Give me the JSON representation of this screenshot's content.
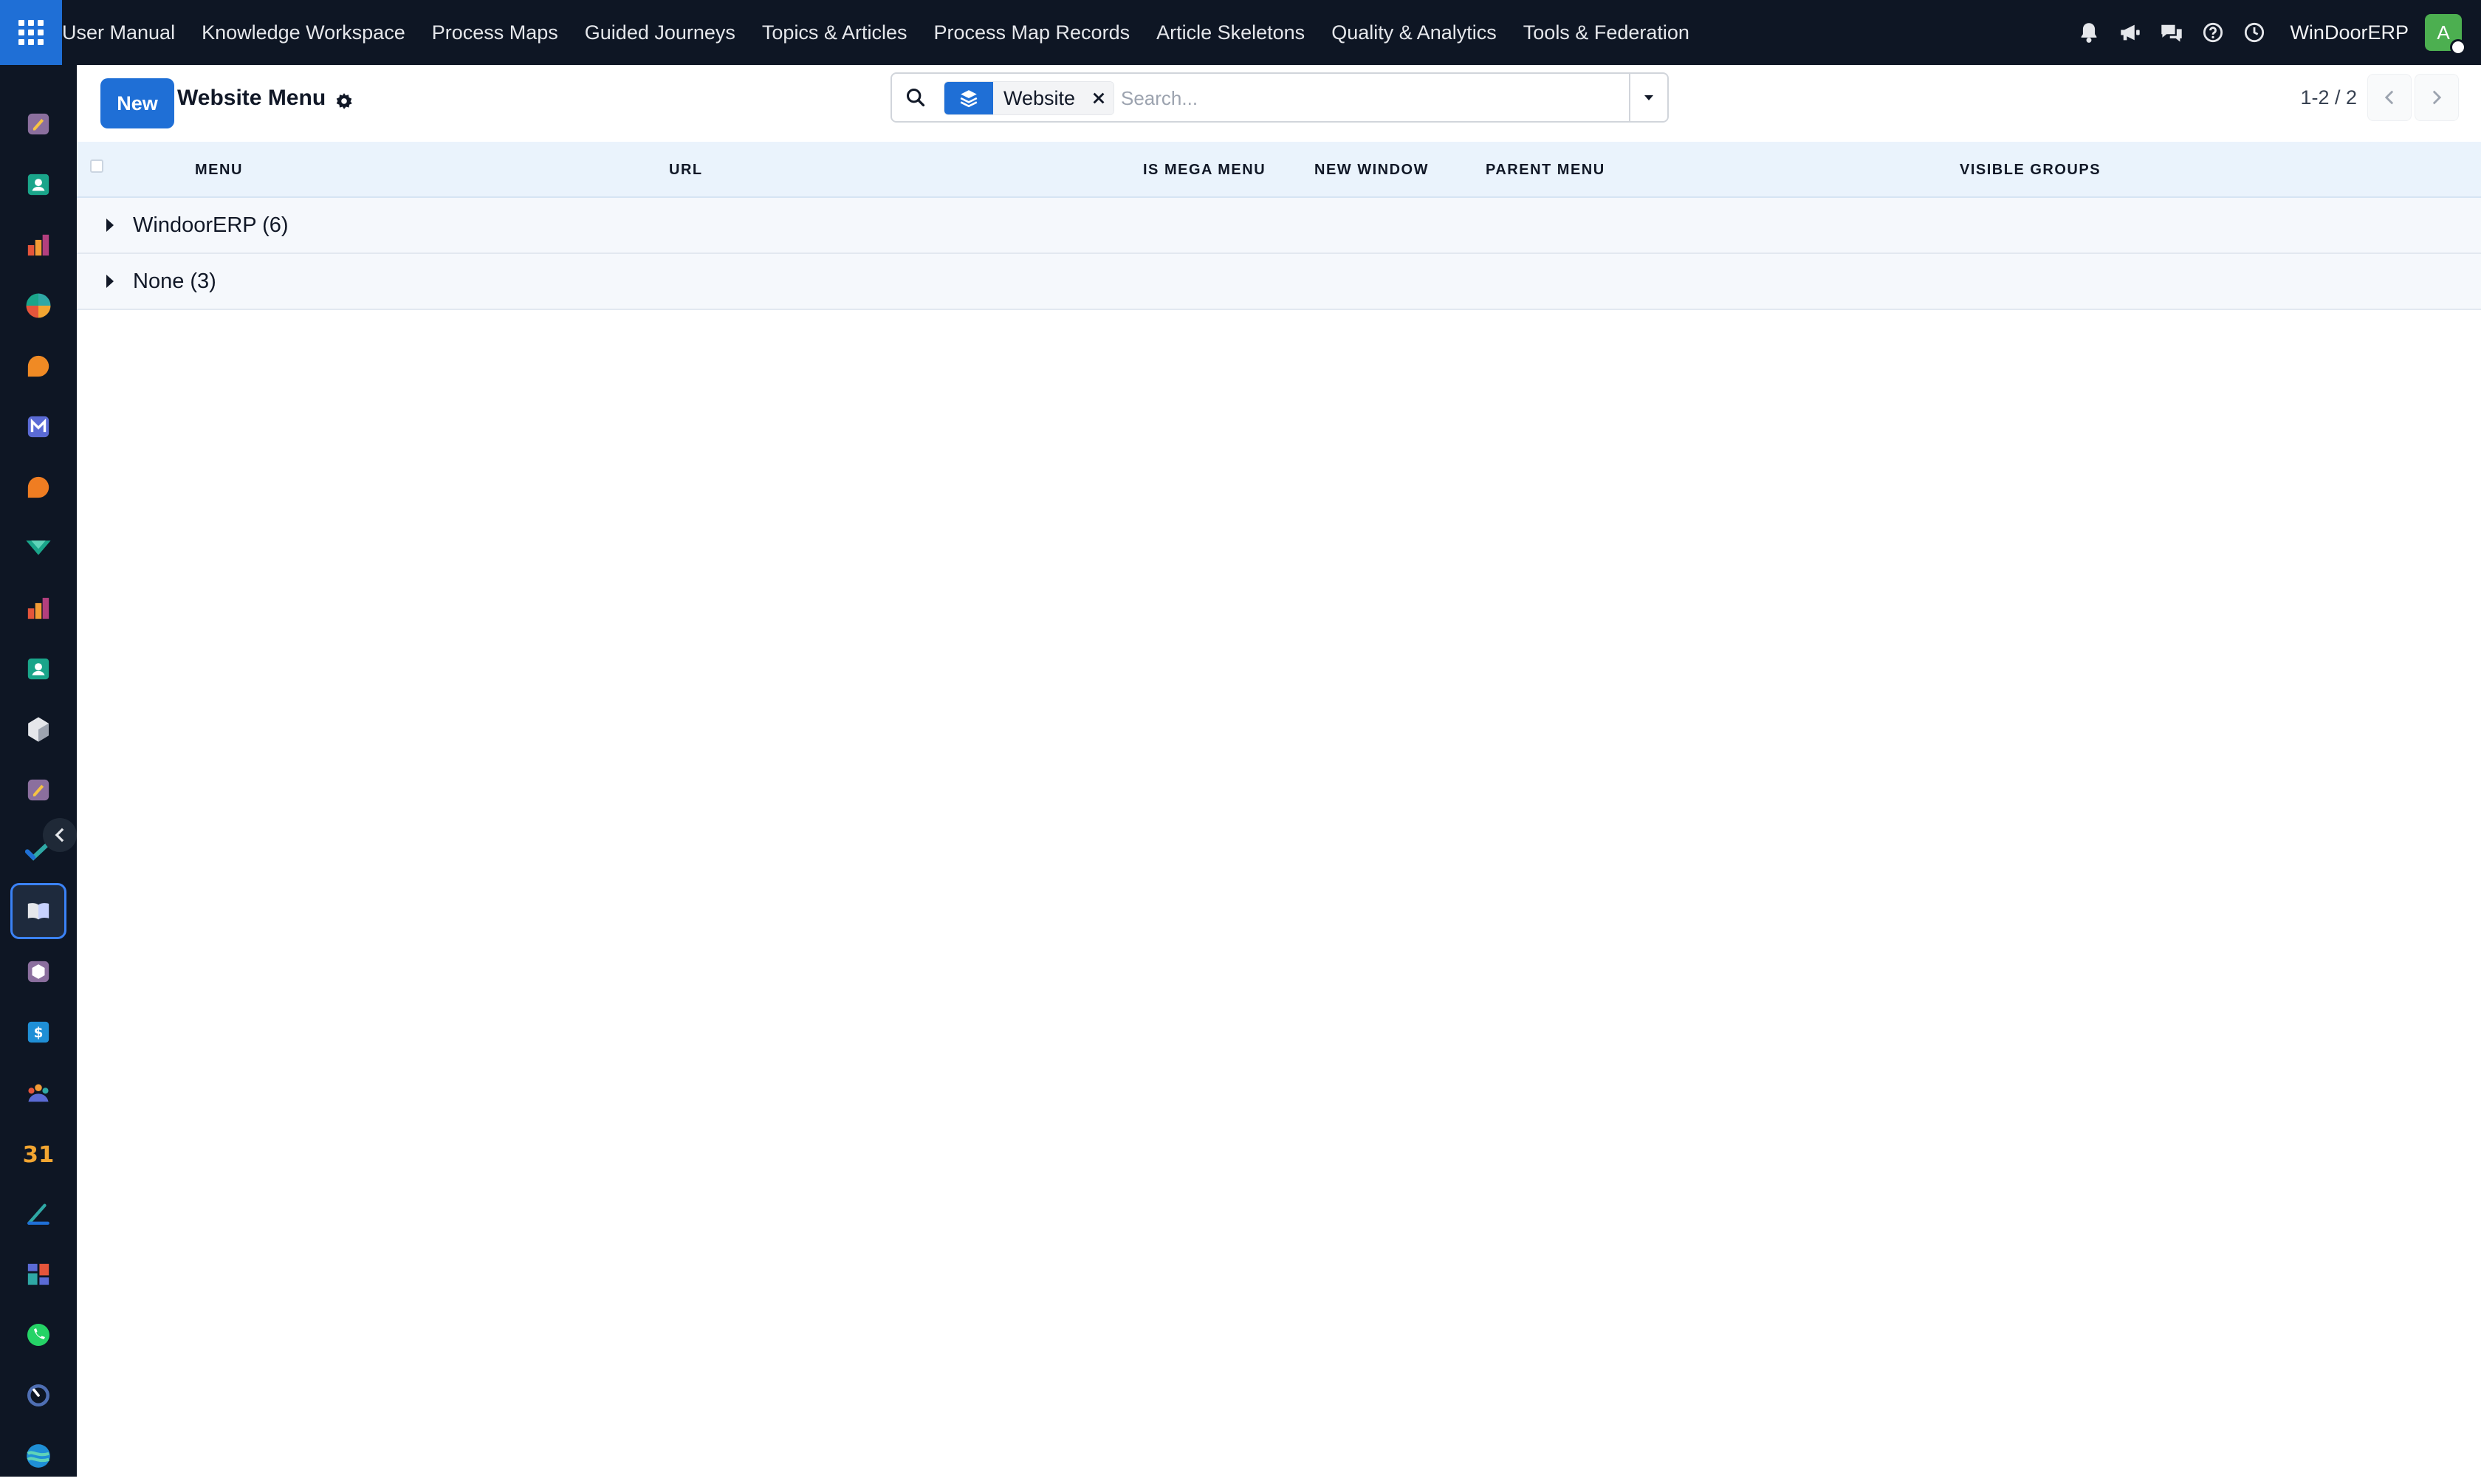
{
  "topbar": {
    "menu": [
      "User Manual",
      "Knowledge Workspace",
      "Process Maps",
      "Guided Journeys",
      "Topics & Articles",
      "Process Map Records",
      "Article Skeletons",
      "Quality & Analytics",
      "Tools & Federation"
    ],
    "company": "WinDoorERP",
    "avatar_initial": "A",
    "accent": "#1f6fd6",
    "background": "#0e1624"
  },
  "rail": {
    "apps": [
      "sign-app",
      "contacts-app",
      "reporting-app",
      "dashboards-app",
      "discuss-app",
      "email-marketing-app",
      "livechat-app",
      "field-service-app",
      "reporting-app-2",
      "contacts-app-2",
      "inventory-app",
      "sign-app-2",
      "todo-app",
      "knowledge-app",
      "product-app",
      "invoicing-app",
      "employees-app",
      "calendar-app",
      "planning-app",
      "dashboard-app",
      "whatsapp-app",
      "timer-app",
      "website-app"
    ],
    "active_index": 13
  },
  "control": {
    "new_label": "New",
    "title": "Website Menu",
    "search": {
      "facet_label": "Website",
      "placeholder": "Search..."
    },
    "pager": "1-2 / 2"
  },
  "table": {
    "columns": [
      "MENU",
      "URL",
      "IS MEGA MENU",
      "NEW WINDOW",
      "PARENT MENU",
      "VISIBLE GROUPS"
    ],
    "groups": [
      {
        "label": "WindoorERP (6)"
      },
      {
        "label": "None (3)"
      }
    ]
  }
}
